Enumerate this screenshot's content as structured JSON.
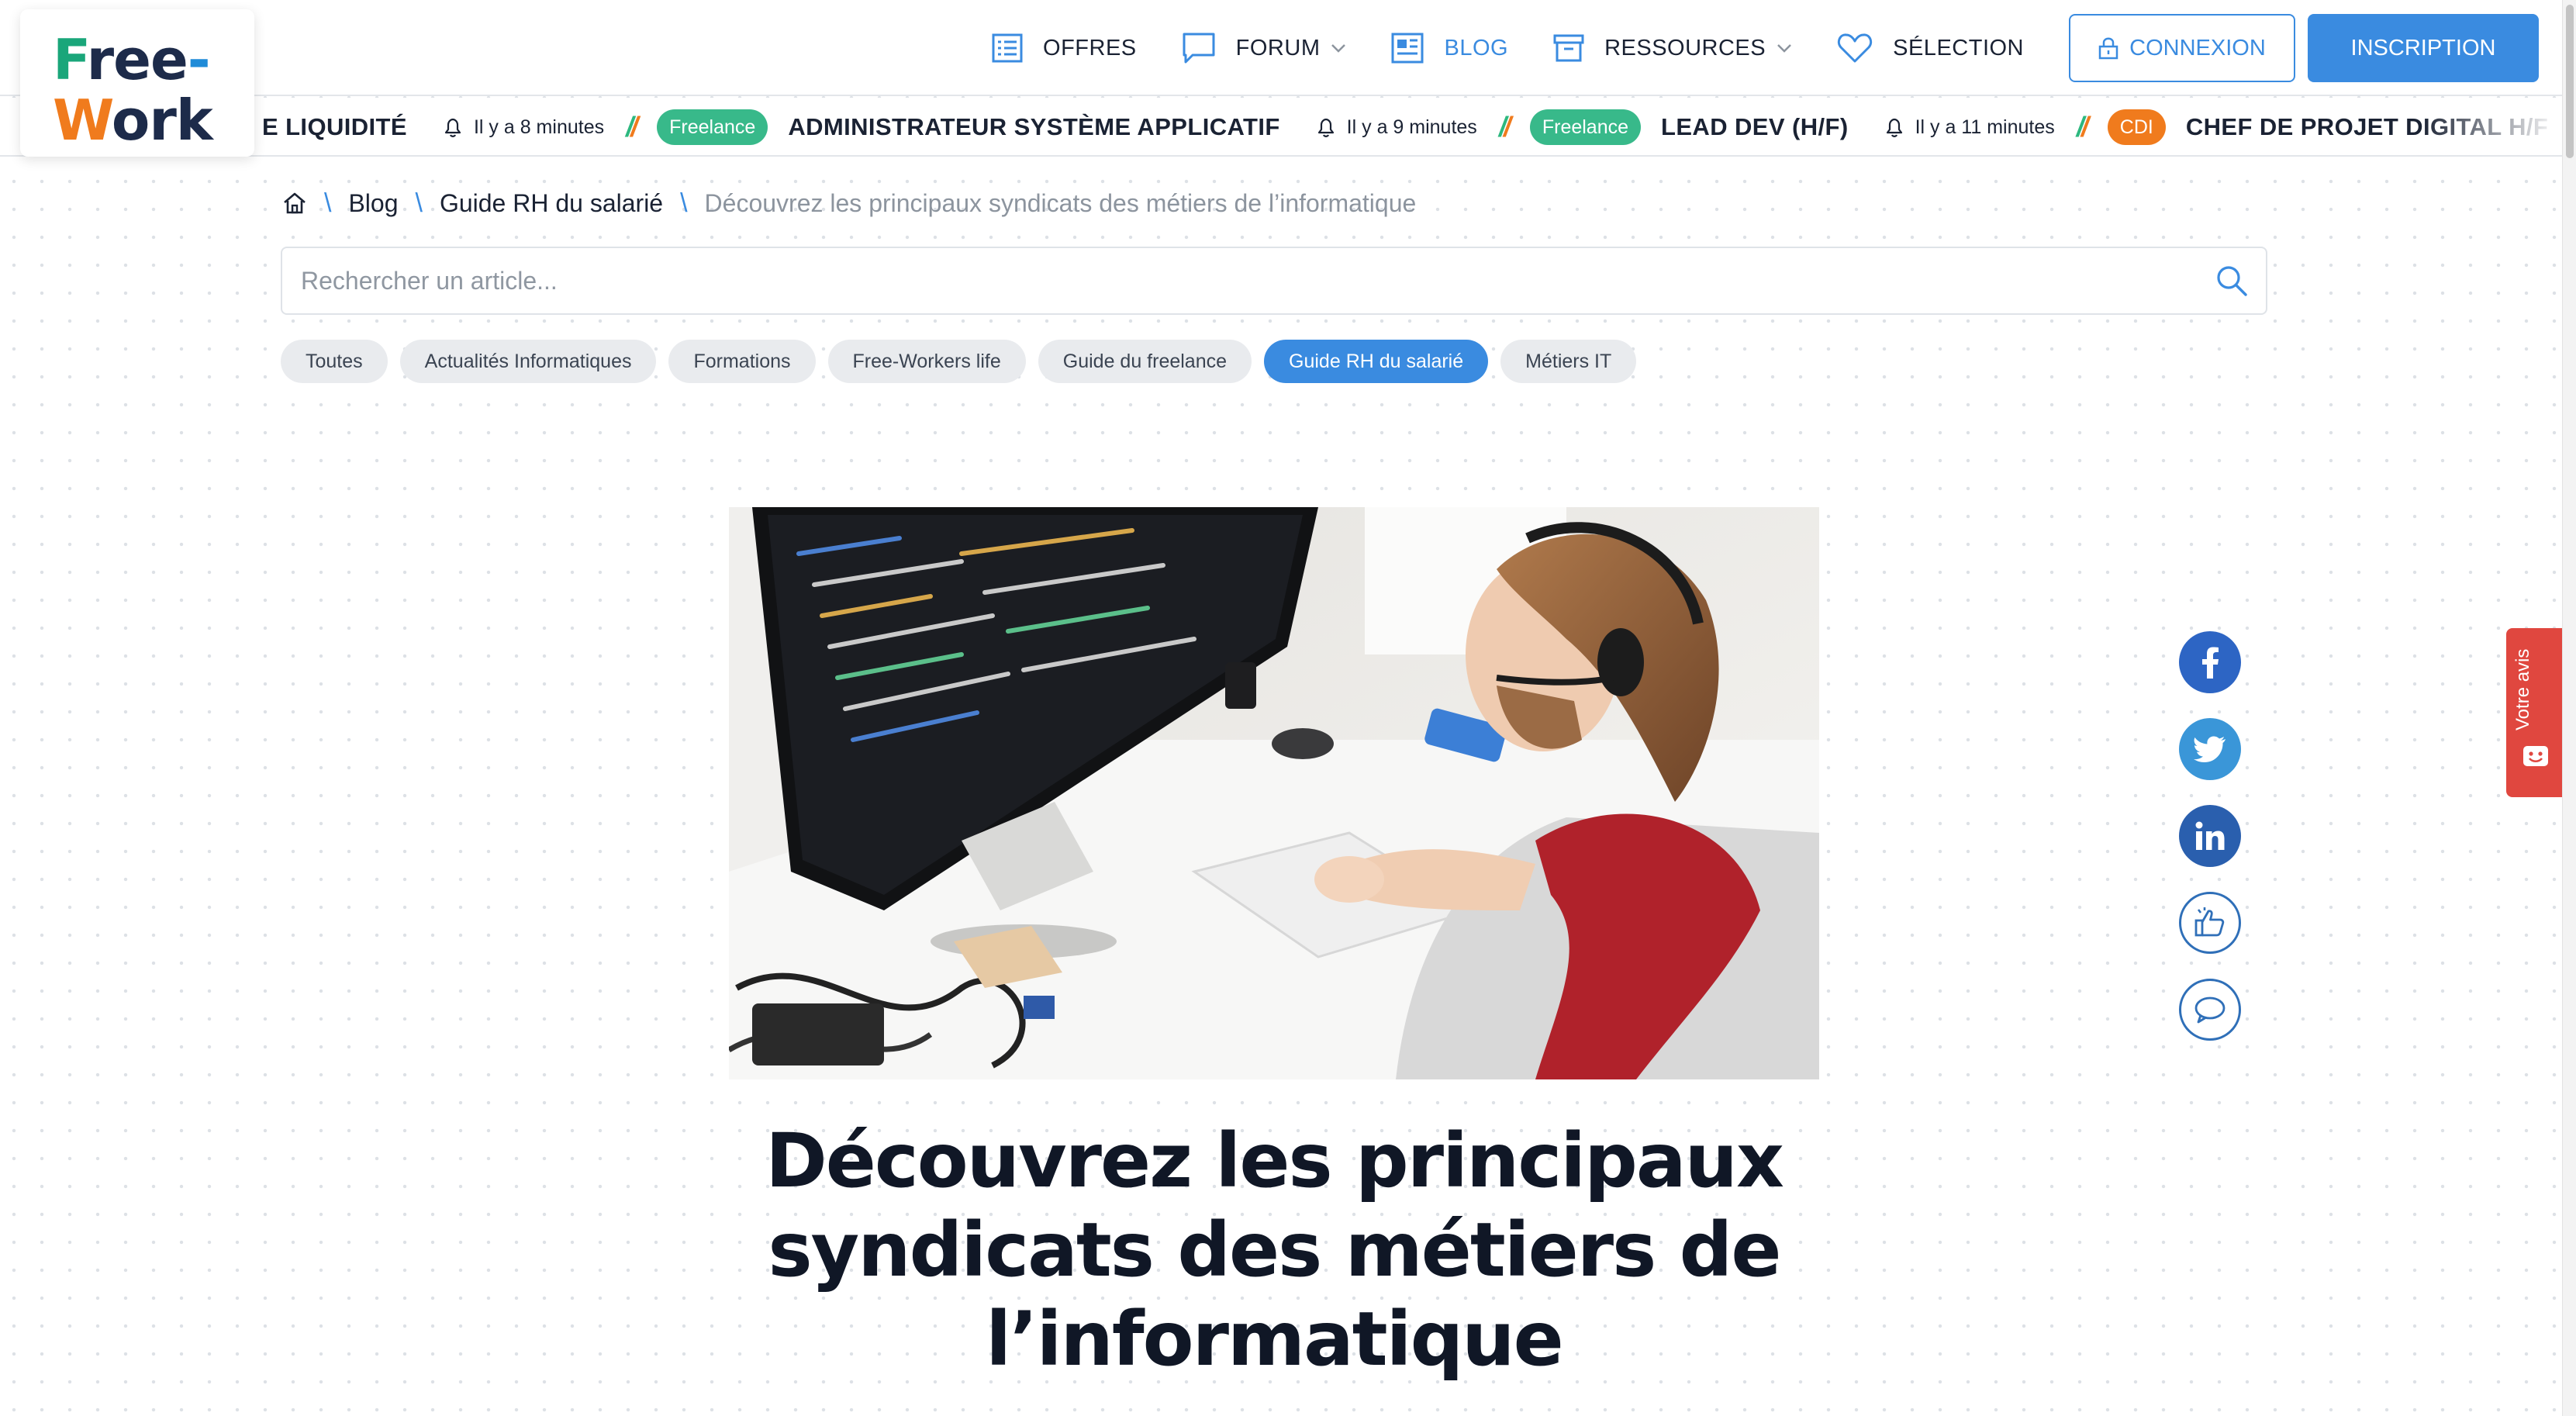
{
  "brand": {
    "logo_line1": "Free-",
    "logo_line2": "Work"
  },
  "nav": {
    "offres": "OFFRES",
    "forum": "FORUM",
    "blog": "BLOG",
    "ressources": "RESSOURCES",
    "selection": "SÉLECTION",
    "connexion": "CONNEXION",
    "inscription": "INSCRIPTION"
  },
  "ticker": {
    "items": [
      {
        "title": "E LIQUIDITÉ",
        "time": "Il y a 8 minutes"
      },
      {
        "badge": "Freelance",
        "title": "ADMINISTRATEUR SYSTÈME APPLICATIF",
        "time": "Il y a 9 minutes"
      },
      {
        "badge": "Freelance",
        "title": "LEAD DEV (H/F)",
        "time": "Il y a 11 minutes"
      },
      {
        "badge": "CDI",
        "title": "CHEF DE PROJET DIGITAL H/F"
      }
    ]
  },
  "breadcrumb": {
    "blog": "Blog",
    "category": "Guide RH du salarié",
    "current": "Découvrez les principaux syndicats des métiers de l’informatique"
  },
  "search": {
    "placeholder": "Rechercher un article..."
  },
  "categories": [
    "Toutes",
    "Actualités Informatiques",
    "Formations",
    "Free-Workers life",
    "Guide du freelance",
    "Guide RH du salarié",
    "Métiers IT"
  ],
  "active_category": "Guide RH du salarié",
  "article": {
    "title": "Découvrez les principaux syndicats des métiers de l’informatique"
  },
  "feedback": {
    "label": "Votre avis"
  },
  "colors": {
    "accent": "#3a8be0",
    "green": "#38b98a",
    "orange": "#f07b1d",
    "feedback": "#e0473f"
  }
}
